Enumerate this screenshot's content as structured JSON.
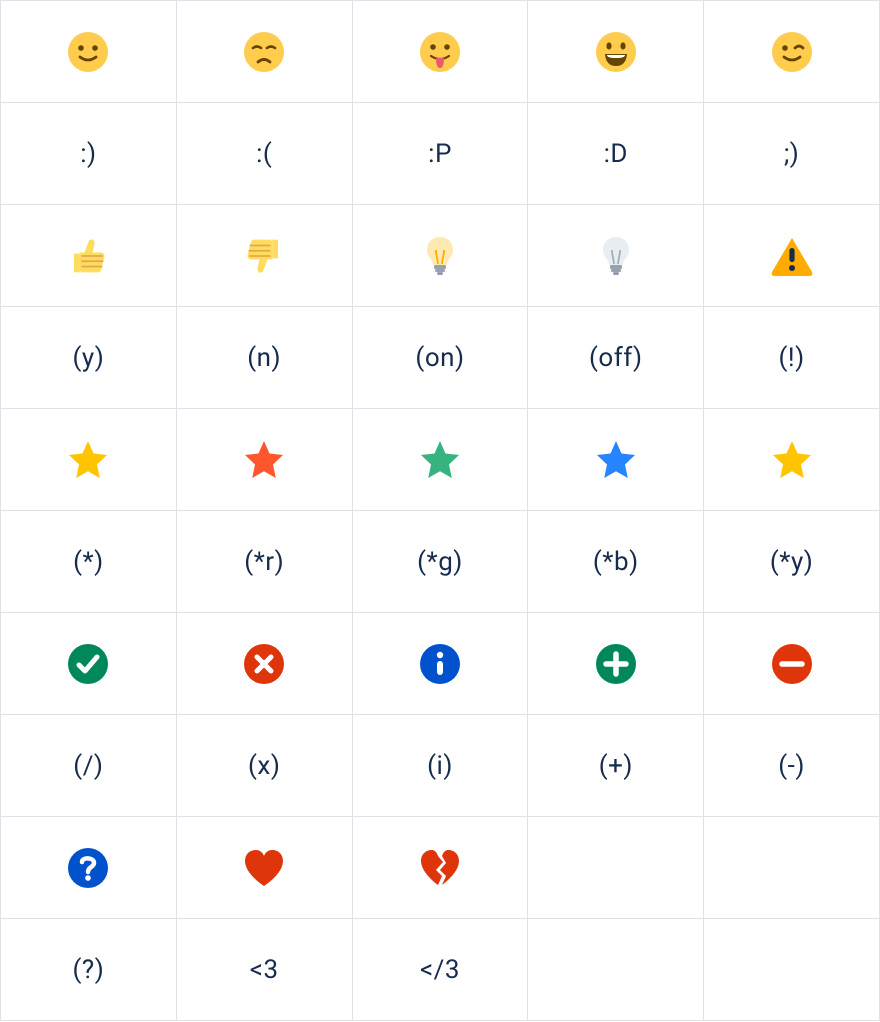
{
  "rows": [
    {
      "cells": [
        {
          "type": "icon",
          "icon": "smile"
        },
        {
          "type": "icon",
          "icon": "sad"
        },
        {
          "type": "icon",
          "icon": "tongue"
        },
        {
          "type": "icon",
          "icon": "biggrin"
        },
        {
          "type": "icon",
          "icon": "wink"
        }
      ]
    },
    {
      "cells": [
        {
          "type": "code",
          "text": ":)"
        },
        {
          "type": "code",
          "text": ":("
        },
        {
          "type": "code",
          "text": ":P"
        },
        {
          "type": "code",
          "text": ":D"
        },
        {
          "type": "code",
          "text": ";)"
        }
      ]
    },
    {
      "cells": [
        {
          "type": "icon",
          "icon": "thumbs-up"
        },
        {
          "type": "icon",
          "icon": "thumbs-down"
        },
        {
          "type": "icon",
          "icon": "light-on"
        },
        {
          "type": "icon",
          "icon": "light-off"
        },
        {
          "type": "icon",
          "icon": "warning"
        }
      ]
    },
    {
      "cells": [
        {
          "type": "code",
          "text": "(y)"
        },
        {
          "type": "code",
          "text": "(n)"
        },
        {
          "type": "code",
          "text": "(on)"
        },
        {
          "type": "code",
          "text": "(off)"
        },
        {
          "type": "code",
          "text": "(!)"
        }
      ]
    },
    {
      "cells": [
        {
          "type": "icon",
          "icon": "star",
          "color": "#FFC400"
        },
        {
          "type": "icon",
          "icon": "star",
          "color": "#FF5630"
        },
        {
          "type": "icon",
          "icon": "star",
          "color": "#36B37E"
        },
        {
          "type": "icon",
          "icon": "star",
          "color": "#2684FF"
        },
        {
          "type": "icon",
          "icon": "star",
          "color": "#FFC400"
        }
      ]
    },
    {
      "cells": [
        {
          "type": "code",
          "text": "(*)"
        },
        {
          "type": "code",
          "text": "(*r)"
        },
        {
          "type": "code",
          "text": "(*g)"
        },
        {
          "type": "code",
          "text": "(*b)"
        },
        {
          "type": "code",
          "text": "(*y)"
        }
      ]
    },
    {
      "cells": [
        {
          "type": "icon",
          "icon": "tick",
          "color": "#00875A"
        },
        {
          "type": "icon",
          "icon": "cross",
          "color": "#DE350B"
        },
        {
          "type": "icon",
          "icon": "info",
          "color": "#0052CC"
        },
        {
          "type": "icon",
          "icon": "plus",
          "color": "#00875A"
        },
        {
          "type": "icon",
          "icon": "minus",
          "color": "#DE350B"
        }
      ]
    },
    {
      "cells": [
        {
          "type": "code",
          "text": "(/)"
        },
        {
          "type": "code",
          "text": "(x)"
        },
        {
          "type": "code",
          "text": "(i)"
        },
        {
          "type": "code",
          "text": "(+)"
        },
        {
          "type": "code",
          "text": "(-)"
        }
      ]
    },
    {
      "cells": [
        {
          "type": "icon",
          "icon": "question",
          "color": "#0052CC"
        },
        {
          "type": "icon",
          "icon": "heart",
          "color": "#DE350B"
        },
        {
          "type": "icon",
          "icon": "broken-heart",
          "color": "#DE350B"
        },
        {
          "type": "empty"
        },
        {
          "type": "empty"
        }
      ]
    },
    {
      "cells": [
        {
          "type": "code",
          "text": "(?)"
        },
        {
          "type": "code",
          "text": "<3"
        },
        {
          "type": "code",
          "text": "</3"
        },
        {
          "type": "empty"
        },
        {
          "type": "empty"
        }
      ]
    }
  ]
}
